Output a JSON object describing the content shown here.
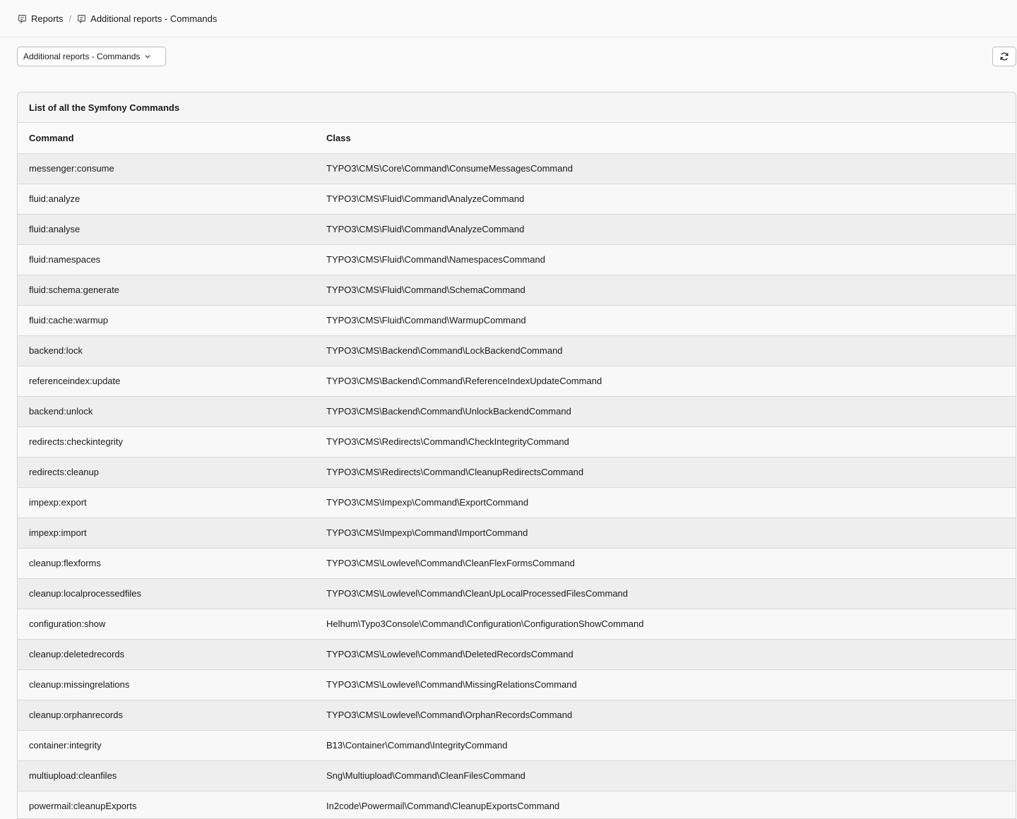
{
  "breadcrumb": {
    "item1": "Reports",
    "separator": "/",
    "item2": "Additional reports - Commands"
  },
  "toolbar": {
    "dropdown_label": "Additional reports - Commands",
    "refresh_icon": "refresh-icon"
  },
  "panel": {
    "title": "List of all the Symfony Commands",
    "headers": {
      "command": "Command",
      "class": "Class"
    },
    "rows": [
      {
        "command": "messenger:consume",
        "class": "TYPO3\\CMS\\Core\\Command\\ConsumeMessagesCommand"
      },
      {
        "command": "fluid:analyze",
        "class": "TYPO3\\CMS\\Fluid\\Command\\AnalyzeCommand"
      },
      {
        "command": "fluid:analyse",
        "class": "TYPO3\\CMS\\Fluid\\Command\\AnalyzeCommand"
      },
      {
        "command": "fluid:namespaces",
        "class": "TYPO3\\CMS\\Fluid\\Command\\NamespacesCommand"
      },
      {
        "command": "fluid:schema:generate",
        "class": "TYPO3\\CMS\\Fluid\\Command\\SchemaCommand"
      },
      {
        "command": "fluid:cache:warmup",
        "class": "TYPO3\\CMS\\Fluid\\Command\\WarmupCommand"
      },
      {
        "command": "backend:lock",
        "class": "TYPO3\\CMS\\Backend\\Command\\LockBackendCommand"
      },
      {
        "command": "referenceindex:update",
        "class": "TYPO3\\CMS\\Backend\\Command\\ReferenceIndexUpdateCommand"
      },
      {
        "command": "backend:unlock",
        "class": "TYPO3\\CMS\\Backend\\Command\\UnlockBackendCommand"
      },
      {
        "command": "redirects:checkintegrity",
        "class": "TYPO3\\CMS\\Redirects\\Command\\CheckIntegrityCommand"
      },
      {
        "command": "redirects:cleanup",
        "class": "TYPO3\\CMS\\Redirects\\Command\\CleanupRedirectsCommand"
      },
      {
        "command": "impexp:export",
        "class": "TYPO3\\CMS\\Impexp\\Command\\ExportCommand"
      },
      {
        "command": "impexp:import",
        "class": "TYPO3\\CMS\\Impexp\\Command\\ImportCommand"
      },
      {
        "command": "cleanup:flexforms",
        "class": "TYPO3\\CMS\\Lowlevel\\Command\\CleanFlexFormsCommand"
      },
      {
        "command": "cleanup:localprocessedfiles",
        "class": "TYPO3\\CMS\\Lowlevel\\Command\\CleanUpLocalProcessedFilesCommand"
      },
      {
        "command": "configuration:show",
        "class": "Helhum\\Typo3Console\\Command\\Configuration\\ConfigurationShowCommand"
      },
      {
        "command": "cleanup:deletedrecords",
        "class": "TYPO3\\CMS\\Lowlevel\\Command\\DeletedRecordsCommand"
      },
      {
        "command": "cleanup:missingrelations",
        "class": "TYPO3\\CMS\\Lowlevel\\Command\\MissingRelationsCommand"
      },
      {
        "command": "cleanup:orphanrecords",
        "class": "TYPO3\\CMS\\Lowlevel\\Command\\OrphanRecordsCommand"
      },
      {
        "command": "container:integrity",
        "class": "B13\\Container\\Command\\IntegrityCommand"
      },
      {
        "command": "multiupload:cleanfiles",
        "class": "Sng\\Multiupload\\Command\\CleanFilesCommand"
      },
      {
        "command": "powermail:cleanupExports",
        "class": "In2code\\Powermail\\Command\\CleanupExportsCommand"
      }
    ]
  }
}
